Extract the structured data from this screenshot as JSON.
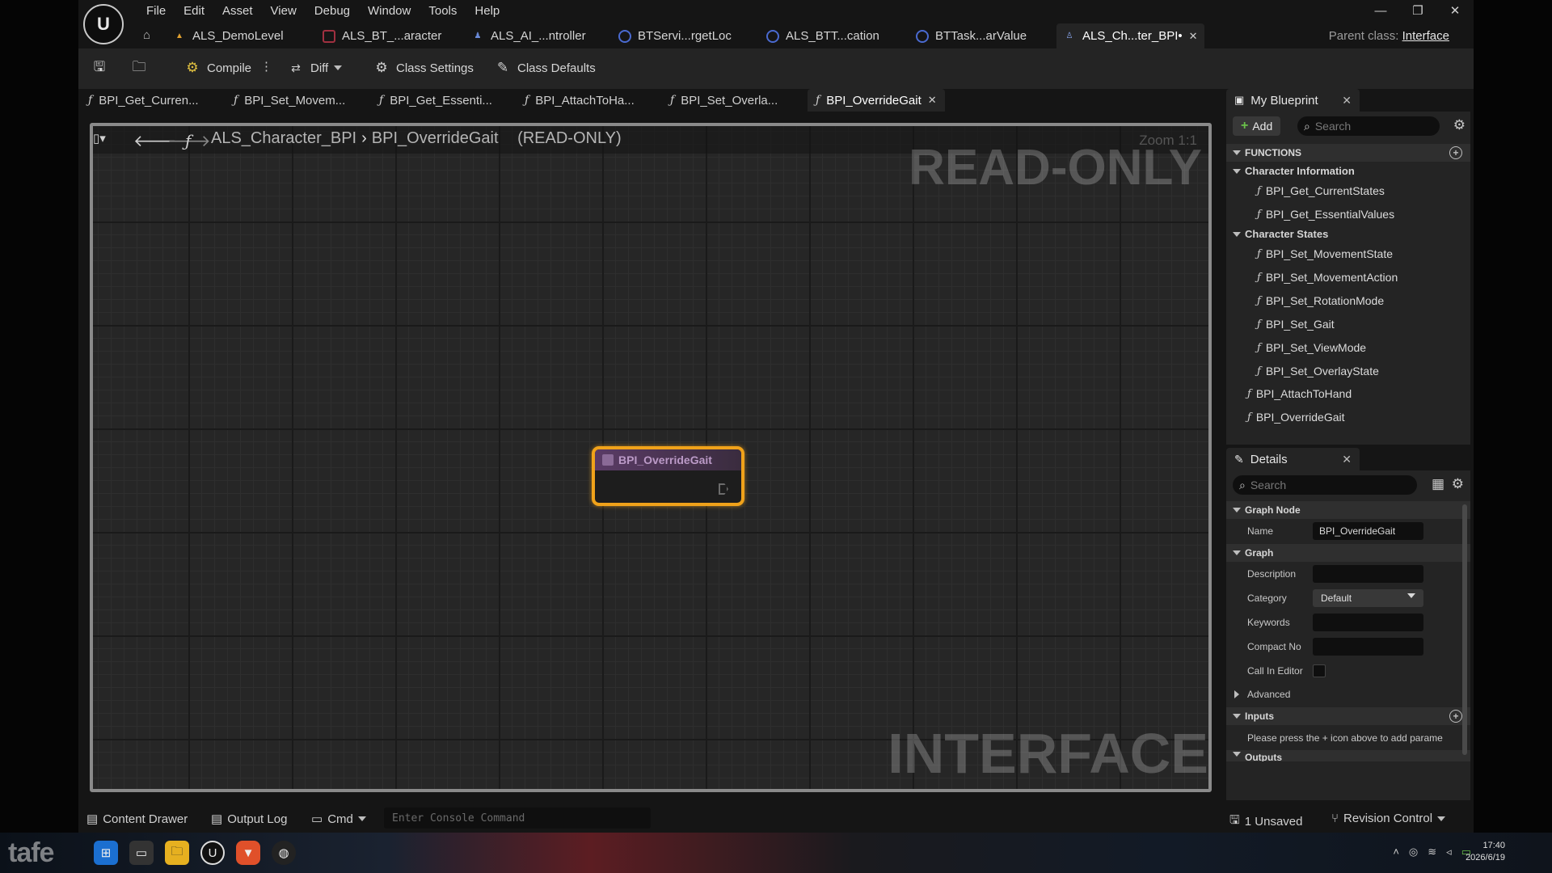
{
  "menu": [
    "File",
    "Edit",
    "Asset",
    "View",
    "Debug",
    "Window",
    "Tools",
    "Help"
  ],
  "asset_tabs": [
    {
      "label": "ALS_DemoLevel",
      "icon": "level-icon"
    },
    {
      "label": "ALS_BT_...aracter",
      "icon": "behavior-tree-icon"
    },
    {
      "label": "ALS_AI_...ntroller",
      "icon": "ai-controller-icon"
    },
    {
      "label": "BTServi...rgetLoc",
      "icon": "blueprint-icon"
    },
    {
      "label": "ALS_BTT...cation",
      "icon": "blueprint-icon"
    },
    {
      "label": "BTTask...arValue",
      "icon": "blueprint-icon"
    },
    {
      "label": "ALS_Ch...ter_BPI•",
      "icon": "interface-icon",
      "active": true
    }
  ],
  "parent_class": {
    "label": "Parent class:",
    "value": "Interface"
  },
  "toolbar": {
    "compile": "Compile",
    "diff": "Diff",
    "class_settings": "Class Settings",
    "class_defaults": "Class Defaults"
  },
  "doc_tabs": [
    "BPI_Get_Curren...",
    "BPI_Set_Movem...",
    "BPI_Get_Essenti...",
    "BPI_AttachToHa...",
    "BPI_Set_Overla...",
    "BPI_OverrideGait"
  ],
  "graph": {
    "breadcrumb_root": "ALS_Character_BPI",
    "breadcrumb_fn": "BPI_OverrideGait",
    "readonly_tag": "(READ-ONLY)",
    "zoom": "Zoom 1:1",
    "watermark_top": "READ-ONLY",
    "watermark_bottom": "INTERFACE",
    "node_title": "BPI_OverrideGait"
  },
  "my_blueprint": {
    "title": "My Blueprint",
    "add": "Add",
    "search_placeholder": "Search",
    "functions_header": "FUNCTIONS",
    "categories": [
      {
        "name": "Character Information",
        "items": [
          "BPI_Get_CurrentStates",
          "BPI_Get_EssentialValues"
        ]
      },
      {
        "name": "Character States",
        "items": [
          "BPI_Set_MovementState",
          "BPI_Set_MovementAction",
          "BPI_Set_RotationMode",
          "BPI_Set_Gait",
          "BPI_Set_ViewMode",
          "BPI_Set_OverlayState"
        ]
      }
    ],
    "uncategorized": [
      "BPI_AttachToHand",
      "BPI_OverrideGait"
    ]
  },
  "details": {
    "title": "Details",
    "search_placeholder": "Search",
    "graph_node_header": "Graph Node",
    "name_label": "Name",
    "name_value": "BPI_OverrideGait",
    "graph_header": "Graph",
    "description_label": "Description",
    "category_label": "Category",
    "category_value": "Default",
    "keywords_label": "Keywords",
    "compact_label": "Compact No",
    "call_in_editor_label": "Call In Editor",
    "advanced_label": "Advanced",
    "inputs_header": "Inputs",
    "inputs_hint": "Please press the + icon above to add parame",
    "outputs_header": "Outputs"
  },
  "status": {
    "content_drawer": "Content Drawer",
    "output_log": "Output Log",
    "cmd": "Cmd",
    "console_placeholder": "Enter Console Command",
    "unsaved": "1 Unsaved",
    "revision_control": "Revision Control"
  },
  "taskbar": {
    "brand": "tafe",
    "time": "17:40",
    "date": "2026/6/19"
  },
  "colors": {
    "node_border": "#f0a21a",
    "node_header": "#5a3b66",
    "accent_green": "#6ac14a"
  }
}
